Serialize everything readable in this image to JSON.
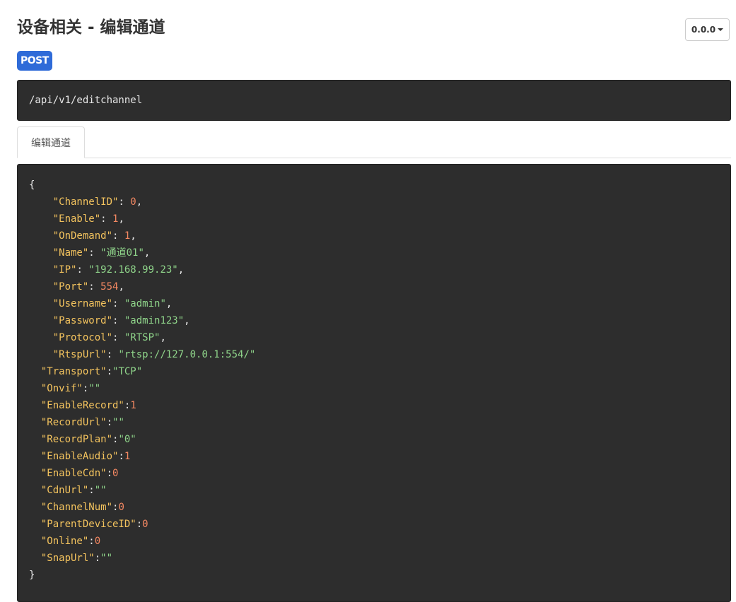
{
  "page": {
    "title": "设备相关 - 编辑通道",
    "version": "0.0.0",
    "method": "POST",
    "endpoint": "/api/v1/editchannel",
    "tab": "编辑通道"
  },
  "request_body": {
    "lines": [
      {
        "i": 0,
        "t": [
          [
            "p",
            "{"
          ]
        ]
      },
      {
        "i": 4,
        "t": [
          [
            "k",
            "\"ChannelID\""
          ],
          [
            "p",
            ": "
          ],
          [
            "n",
            "0"
          ],
          [
            "p",
            ","
          ]
        ]
      },
      {
        "i": 4,
        "t": [
          [
            "k",
            "\"Enable\""
          ],
          [
            "p",
            ": "
          ],
          [
            "n",
            "1"
          ],
          [
            "p",
            ","
          ]
        ]
      },
      {
        "i": 4,
        "t": [
          [
            "k",
            "\"OnDemand\""
          ],
          [
            "p",
            ": "
          ],
          [
            "n",
            "1"
          ],
          [
            "p",
            ","
          ]
        ]
      },
      {
        "i": 4,
        "t": [
          [
            "k",
            "\"Name\""
          ],
          [
            "p",
            ": "
          ],
          [
            "s",
            "\"通道01\""
          ],
          [
            "p",
            ","
          ]
        ]
      },
      {
        "i": 4,
        "t": [
          [
            "k",
            "\"IP\""
          ],
          [
            "p",
            ": "
          ],
          [
            "s",
            "\"192.168.99.23\""
          ],
          [
            "p",
            ","
          ]
        ]
      },
      {
        "i": 4,
        "t": [
          [
            "k",
            "\"Port\""
          ],
          [
            "p",
            ": "
          ],
          [
            "n",
            "554"
          ],
          [
            "p",
            ","
          ]
        ]
      },
      {
        "i": 4,
        "t": [
          [
            "k",
            "\"Username\""
          ],
          [
            "p",
            ": "
          ],
          [
            "s",
            "\"admin\""
          ],
          [
            "p",
            ","
          ]
        ]
      },
      {
        "i": 4,
        "t": [
          [
            "k",
            "\"Password\""
          ],
          [
            "p",
            ": "
          ],
          [
            "s",
            "\"admin123\""
          ],
          [
            "p",
            ","
          ]
        ]
      },
      {
        "i": 4,
        "t": [
          [
            "k",
            "\"Protocol\""
          ],
          [
            "p",
            ": "
          ],
          [
            "s",
            "\"RTSP\""
          ],
          [
            "p",
            ","
          ]
        ]
      },
      {
        "i": 4,
        "t": [
          [
            "k",
            "\"RtspUrl\""
          ],
          [
            "p",
            ": "
          ],
          [
            "s",
            "\"rtsp://127.0.0.1:554/\""
          ]
        ]
      },
      {
        "i": 2,
        "t": [
          [
            "k",
            "\"Transport\""
          ],
          [
            "p",
            ":"
          ],
          [
            "s",
            "\"TCP\""
          ]
        ]
      },
      {
        "i": 2,
        "t": [
          [
            "k",
            "\"Onvif\""
          ],
          [
            "p",
            ":"
          ],
          [
            "s",
            "\"\""
          ]
        ]
      },
      {
        "i": 2,
        "t": [
          [
            "k",
            "\"EnableRecord\""
          ],
          [
            "p",
            ":"
          ],
          [
            "n",
            "1"
          ]
        ]
      },
      {
        "i": 2,
        "t": [
          [
            "k",
            "\"RecordUrl\""
          ],
          [
            "p",
            ":"
          ],
          [
            "s",
            "\"\""
          ]
        ]
      },
      {
        "i": 2,
        "t": [
          [
            "k",
            "\"RecordPlan\""
          ],
          [
            "p",
            ":"
          ],
          [
            "s",
            "\"0\""
          ]
        ]
      },
      {
        "i": 2,
        "t": [
          [
            "k",
            "\"EnableAudio\""
          ],
          [
            "p",
            ":"
          ],
          [
            "n",
            "1"
          ]
        ]
      },
      {
        "i": 2,
        "t": [
          [
            "k",
            "\"EnableCdn\""
          ],
          [
            "p",
            ":"
          ],
          [
            "n",
            "0"
          ]
        ]
      },
      {
        "i": 2,
        "t": [
          [
            "k",
            "\"CdnUrl\""
          ],
          [
            "p",
            ":"
          ],
          [
            "s",
            "\"\""
          ]
        ]
      },
      {
        "i": 2,
        "t": [
          [
            "k",
            "\"ChannelNum\""
          ],
          [
            "p",
            ":"
          ],
          [
            "n",
            "0"
          ]
        ]
      },
      {
        "i": 2,
        "t": [
          [
            "k",
            "\"ParentDeviceID\""
          ],
          [
            "p",
            ":"
          ],
          [
            "n",
            "0"
          ]
        ]
      },
      {
        "i": 2,
        "t": [
          [
            "k",
            "\"Online\""
          ],
          [
            "p",
            ":"
          ],
          [
            "n",
            "0"
          ]
        ]
      },
      {
        "i": 2,
        "t": [
          [
            "k",
            "\"SnapUrl\""
          ],
          [
            "p",
            ":"
          ],
          [
            "s",
            "\"\""
          ]
        ]
      },
      {
        "i": 0,
        "t": [
          [
            "p",
            "}"
          ]
        ]
      }
    ]
  },
  "colors": {
    "badge": "#2f6bd8",
    "code_bg": "#2d2d2d",
    "key": "#f3c35e",
    "string": "#8fd48a",
    "number": "#f48862"
  }
}
